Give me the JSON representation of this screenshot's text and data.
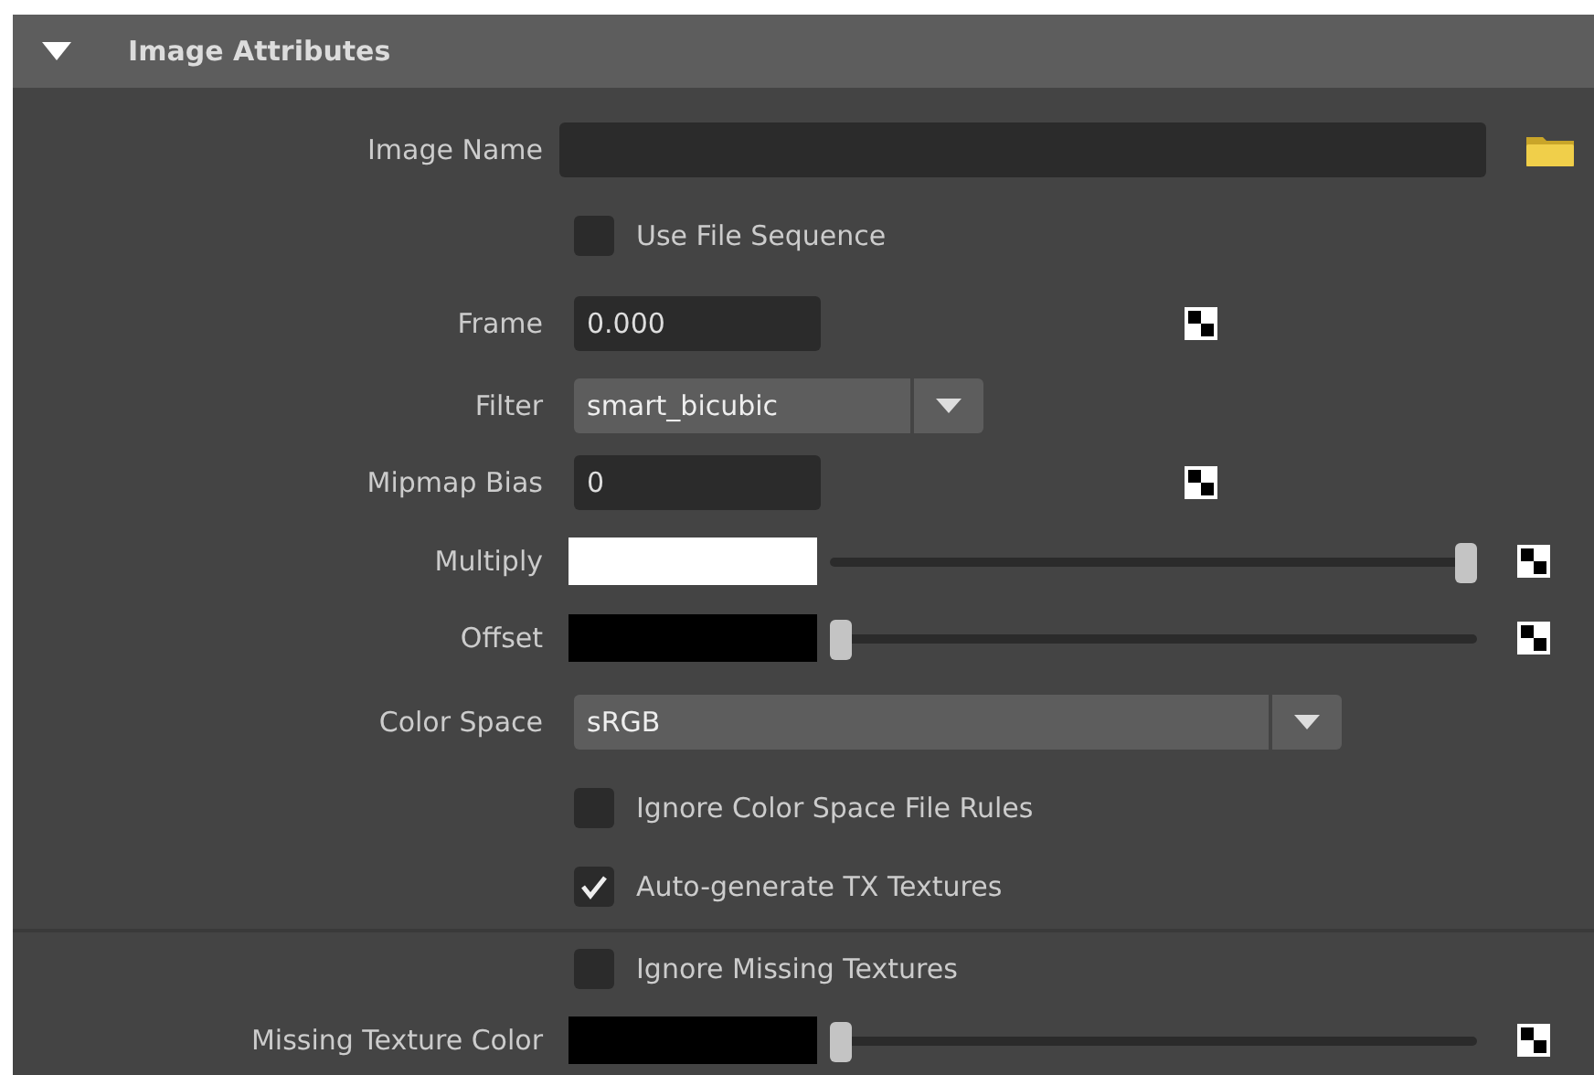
{
  "section": {
    "title": "Image Attributes",
    "expanded": true
  },
  "rows": [
    {
      "kind": "file",
      "label": "Image Name",
      "value": ""
    },
    {
      "kind": "checkbox",
      "label": "Use File Sequence",
      "checked": false
    },
    {
      "kind": "number",
      "label": "Frame",
      "value": "0.000"
    },
    {
      "kind": "dropdown",
      "label": "Filter",
      "value": "smart_bicubic"
    },
    {
      "kind": "number",
      "label": "Mipmap Bias",
      "value": "0"
    },
    {
      "kind": "color",
      "label": "Multiply",
      "color": "#ffffff",
      "level": 1
    },
    {
      "kind": "color",
      "label": "Offset",
      "color": "#000000",
      "level": 0
    },
    {
      "kind": "dropdown_wide",
      "label": "Color Space",
      "value": "sRGB"
    },
    {
      "kind": "checkbox",
      "label": "Ignore Color Space File Rules",
      "checked": false
    },
    {
      "kind": "checkbox",
      "label": "Auto-generate TX Textures",
      "checked": true
    },
    {
      "kind": "checkbox",
      "label": "Ignore Missing Textures",
      "checked": false,
      "divider_above": true
    },
    {
      "kind": "color",
      "label": "Missing Texture Color",
      "color": "#000000",
      "level": 0
    }
  ]
}
